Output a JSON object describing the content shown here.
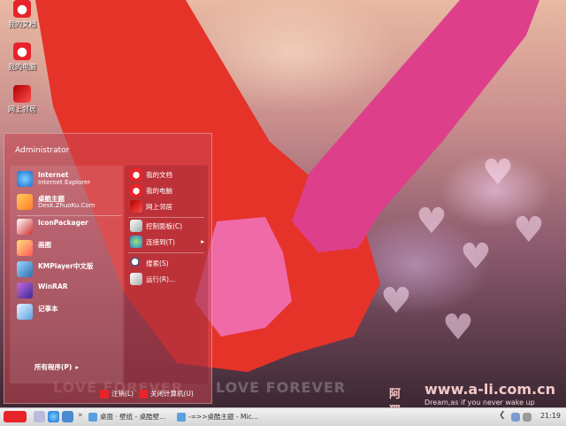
{
  "desktop": {
    "icons": [
      {
        "label": "我的文档"
      },
      {
        "label": "我的电脑"
      },
      {
        "label": "网上邻居"
      }
    ],
    "watermark_text": "LOVE FOREVER",
    "brand": {
      "name_cn": "阿狸",
      "url": "www.a-li.com.cn",
      "tagline": "Dream,as if you never wake up"
    }
  },
  "start_menu": {
    "user": "Administrator",
    "pinned": [
      {
        "label": "Internet",
        "sub": "Internet Explorer"
      },
      {
        "label": "桌酷主题",
        "sub": "Desk.ZhuoKu.Com"
      }
    ],
    "programs": [
      {
        "label": "IconPackager"
      },
      {
        "label": "画图"
      },
      {
        "label": "KMPlayer中文版"
      },
      {
        "label": "WinRAR"
      },
      {
        "label": "记事本"
      }
    ],
    "all_programs": "所有程序(P)",
    "right": [
      {
        "label": "我的文档"
      },
      {
        "label": "我的电脑"
      },
      {
        "label": "网上邻居"
      },
      {
        "label": "控制面板(C)"
      },
      {
        "label": "连接到(T)"
      },
      {
        "label": "搜索(S)"
      },
      {
        "label": "运行(R)..."
      }
    ],
    "footer": {
      "logoff": "注销(L)",
      "shutdown": "关闭计算机(U)"
    }
  },
  "taskbar": {
    "tasks": [
      {
        "label": "桌面 · 壁纸 - 桌酷壁..."
      },
      {
        "label": "-=>>桌酷主题 - Mic..."
      }
    ],
    "clock": "21:19"
  },
  "colors": {
    "menu_bg": "#c8465080",
    "taskbar": "#e0e0e0",
    "accent_red": "#e8232a"
  }
}
